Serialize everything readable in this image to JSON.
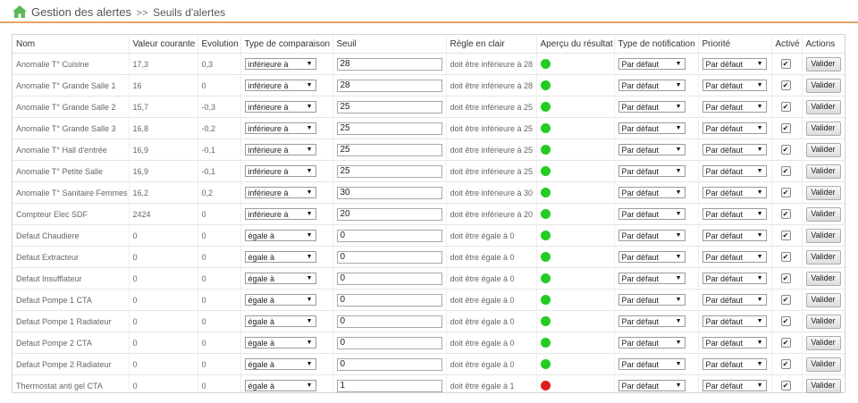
{
  "header": {
    "title": "Gestion des alertes",
    "separator": ">>",
    "subtitle": "Seuils d'alertes"
  },
  "columns": {
    "nom": "Nom",
    "valeur": "Valeur courante",
    "evolution": "Evolution",
    "type": "Type de comparaison",
    "seuil": "Seuil",
    "regle": "Règle en clair",
    "apercu": "Aperçu du résultat",
    "notif": "Type de notification",
    "priorite": "Priorité",
    "active": "Activé",
    "actions": "Actions"
  },
  "arrow_glyph": "▼",
  "check_glyph": "✔",
  "button_label": "Valider",
  "status_colors": {
    "green": "#22cc22",
    "red": "#e02020"
  },
  "rows": [
    {
      "nom": "Anomalie T° Cuisine",
      "valeur": "17,3",
      "evolution": "0,3",
      "type": "inférieure à",
      "seuil": "28",
      "regle": "doit être inférieure à 28",
      "status": "green",
      "notif": "Par défaut",
      "priorite": "Par défaut",
      "active": true
    },
    {
      "nom": "Anomalie T° Grande Salle 1",
      "valeur": "16",
      "evolution": "0",
      "type": "inférieure à",
      "seuil": "28",
      "regle": "doit être inférieure à 28",
      "status": "green",
      "notif": "Par défaut",
      "priorite": "Par défaut",
      "active": true
    },
    {
      "nom": "Anomalie T° Grande Salle 2",
      "valeur": "15,7",
      "evolution": "-0,3",
      "type": "inférieure à",
      "seuil": "25",
      "regle": "doit être inférieure à 25",
      "status": "green",
      "notif": "Par défaut",
      "priorite": "Par défaut",
      "active": true
    },
    {
      "nom": "Anomalie T° Grande Salle 3",
      "valeur": "16,8",
      "evolution": "-0,2",
      "type": "inférieure à",
      "seuil": "25",
      "regle": "doit être inférieure à 25",
      "status": "green",
      "notif": "Par défaut",
      "priorite": "Par défaut",
      "active": true
    },
    {
      "nom": "Anomalie T° Hall d'entrée",
      "valeur": "16,9",
      "evolution": "-0,1",
      "type": "inférieure à",
      "seuil": "25",
      "regle": "doit être inférieure à 25",
      "status": "green",
      "notif": "Par défaut",
      "priorite": "Par défaut",
      "active": true
    },
    {
      "nom": "Anomalie T° Petite Salle",
      "valeur": "16,9",
      "evolution": "-0,1",
      "type": "inférieure à",
      "seuil": "25",
      "regle": "doit être inférieure à 25",
      "status": "green",
      "notif": "Par défaut",
      "priorite": "Par défaut",
      "active": true
    },
    {
      "nom": "Anomalie T° Sanitaire Femmes",
      "valeur": "16,2",
      "evolution": "0,2",
      "type": "inférieure à",
      "seuil": "30",
      "regle": "doit être inférieure à 30",
      "status": "green",
      "notif": "Par défaut",
      "priorite": "Par défaut",
      "active": true
    },
    {
      "nom": "Compteur Elec SDF",
      "valeur": "2424",
      "evolution": "0",
      "type": "inférieure à",
      "seuil": "20",
      "regle": "doit être inférieure à 20",
      "status": "green",
      "notif": "Par défaut",
      "priorite": "Par défaut",
      "active": true
    },
    {
      "nom": "Defaut Chaudiere",
      "valeur": "0",
      "evolution": "0",
      "type": "égale à",
      "seuil": "0",
      "regle": "doit être égale à 0",
      "status": "green",
      "notif": "Par défaut",
      "priorite": "Par défaut",
      "active": true
    },
    {
      "nom": "Defaut Extracteur",
      "valeur": "0",
      "evolution": "0",
      "type": "égale à",
      "seuil": "0",
      "regle": "doit être égale à 0",
      "status": "green",
      "notif": "Par défaut",
      "priorite": "Par défaut",
      "active": true
    },
    {
      "nom": "Defaut Insufflateur",
      "valeur": "0",
      "evolution": "0",
      "type": "égale à",
      "seuil": "0",
      "regle": "doit être égale à 0",
      "status": "green",
      "notif": "Par défaut",
      "priorite": "Par défaut",
      "active": true
    },
    {
      "nom": "Defaut Pompe 1 CTA",
      "valeur": "0",
      "evolution": "0",
      "type": "égale à",
      "seuil": "0",
      "regle": "doit être égale à 0",
      "status": "green",
      "notif": "Par défaut",
      "priorite": "Par défaut",
      "active": true
    },
    {
      "nom": "Defaut Pompe 1 Radiateur",
      "valeur": "0",
      "evolution": "0",
      "type": "égale à",
      "seuil": "0",
      "regle": "doit être égale à 0",
      "status": "green",
      "notif": "Par défaut",
      "priorite": "Par défaut",
      "active": true
    },
    {
      "nom": "Defaut Pompe 2 CTA",
      "valeur": "0",
      "evolution": "0",
      "type": "égale à",
      "seuil": "0",
      "regle": "doit être égale à 0",
      "status": "green",
      "notif": "Par défaut",
      "priorite": "Par défaut",
      "active": true
    },
    {
      "nom": "Defaut Pompe 2 Radiateur",
      "valeur": "0",
      "evolution": "0",
      "type": "égale à",
      "seuil": "0",
      "regle": "doit être égale à 0",
      "status": "green",
      "notif": "Par défaut",
      "priorite": "Par défaut",
      "active": true
    },
    {
      "nom": "Thermostat anti gel CTA",
      "valeur": "0",
      "evolution": "0",
      "type": "égale à",
      "seuil": "1",
      "regle": "doit être égale à 1",
      "status": "red",
      "notif": "Par défaut",
      "priorite": "Par défaut",
      "active": true
    }
  ]
}
